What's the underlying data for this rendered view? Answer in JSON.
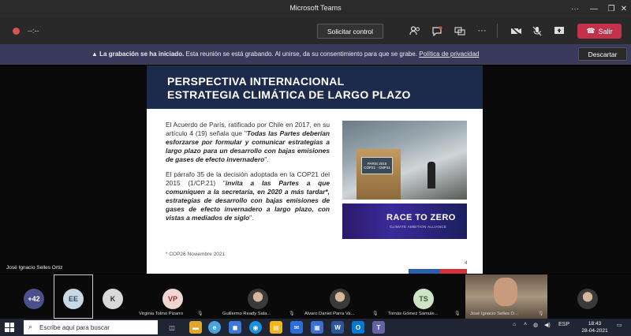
{
  "window": {
    "title": "Microsoft Teams"
  },
  "toolbar": {
    "timer": "--:--",
    "request_control_label": "Solicitar control",
    "leave_label": "Salir",
    "icons": [
      "participants-icon",
      "chat-icon",
      "rooms-icon",
      "more-icon",
      "camera-off-icon",
      "mic-off-icon",
      "share-icon"
    ]
  },
  "banner": {
    "bold": "La grabación se ha iniciado.",
    "text": "Esta reunión se está grabando. Al unirse, da su consentimiento para que se grabe.",
    "link": "Política de privacidad",
    "dismiss_label": "Descartar"
  },
  "slide": {
    "title_line1": "PERSPECTIVA INTERNACIONAL",
    "title_line2": "ESTRATEGIA CLIMÁTICA DE LARGO PLAZO",
    "para1_intro": "El Acuerdo de París, ratificado por Chile en 2017, en su artículo 4 (19) señala que \"",
    "para1_quote": "Todas las Partes deberían esforzarse por formular y comunicar estrategias a largo plazo para un desarrollo con bajas emisiones de gases de efecto invernadero",
    "para1_end": "\".",
    "para2_intro": "El párrafo 35 de la decisión adoptada en la COP21 del 2015 (1/CP.21) \"",
    "para2_quote": "invita a las Partes a que comuniquen a la secretaría, en 2020 a más tardar*, estrategias de desarrollo con bajas emisiones de gases de efecto invernadero a largo plazo, con vistas a mediados de siglo",
    "para2_end": "\".",
    "footnote": "* COP26 Noviembre 2021",
    "page_number": "4",
    "photo_sign": "PARIS 2015 COP21 · CMP11",
    "race_title": "RACE TO ZERO",
    "race_subtitle": "CLIMATE AMBITION ALLIANCE"
  },
  "presenter_name": "José Ignacio Selles Ortiz",
  "participants": [
    {
      "initials": "+42",
      "name": "",
      "color": "#4b4f8a"
    },
    {
      "initials": "EE",
      "name": "",
      "color": "#c8d9e6"
    },
    {
      "initials": "K",
      "name": "",
      "color": "#d9d9d9"
    },
    {
      "initials": "VP",
      "name": "Virginia Tolmo Pizarro",
      "color": "#f0d5d1"
    },
    {
      "initials": "",
      "name": "Guillermo Ready Sala...",
      "color": ""
    },
    {
      "initials": "",
      "name": "Alvaro Daniel Parra Va...",
      "color": ""
    },
    {
      "initials": "TS",
      "name": "Tomás Gómez Samule...",
      "color": "#cfe3c6"
    },
    {
      "initials": "",
      "name": "José Ignacio Selles O...",
      "color": ""
    },
    {
      "initials": "",
      "name": "",
      "color": ""
    }
  ],
  "taskbar": {
    "search_placeholder": "Escribe aquí para buscar",
    "lang": "ESP",
    "time": "18:43",
    "date": "28-04-2021"
  }
}
